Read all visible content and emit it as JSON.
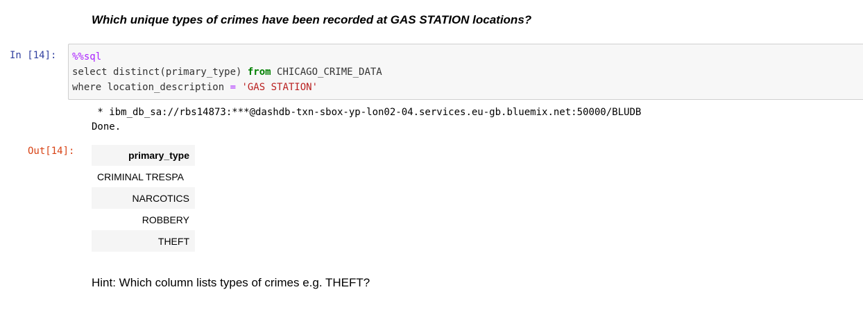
{
  "markdown": {
    "question": "Which unique types of crimes have been recorded at GAS STATION locations?",
    "hint": "Hint: Which column lists types of crimes e.g. THEFT?"
  },
  "cell": {
    "in_prompt": "In [14]:",
    "out_prompt": "Out[14]:",
    "code": {
      "magic": "%%sql",
      "line1_pre": "select distinct(primary_type) ",
      "line1_kw": "from",
      "line1_post": " CHICAGO_CRIME_DATA",
      "line2_pre": "where location_description ",
      "line2_op": "=",
      "line2_str": "'GAS STATION'"
    },
    "stream": {
      "connection": " * ibm_db_sa://rbs14873:***@dashdb-txn-sbox-yp-lon02-04.services.eu-gb.bluemix.net:50000/BLUDB",
      "done": "Done."
    },
    "table": {
      "header": "primary_type",
      "rows": [
        "CRIMINAL TRESPA",
        "NARCOTICS",
        "ROBBERY",
        "THEFT"
      ]
    }
  }
}
